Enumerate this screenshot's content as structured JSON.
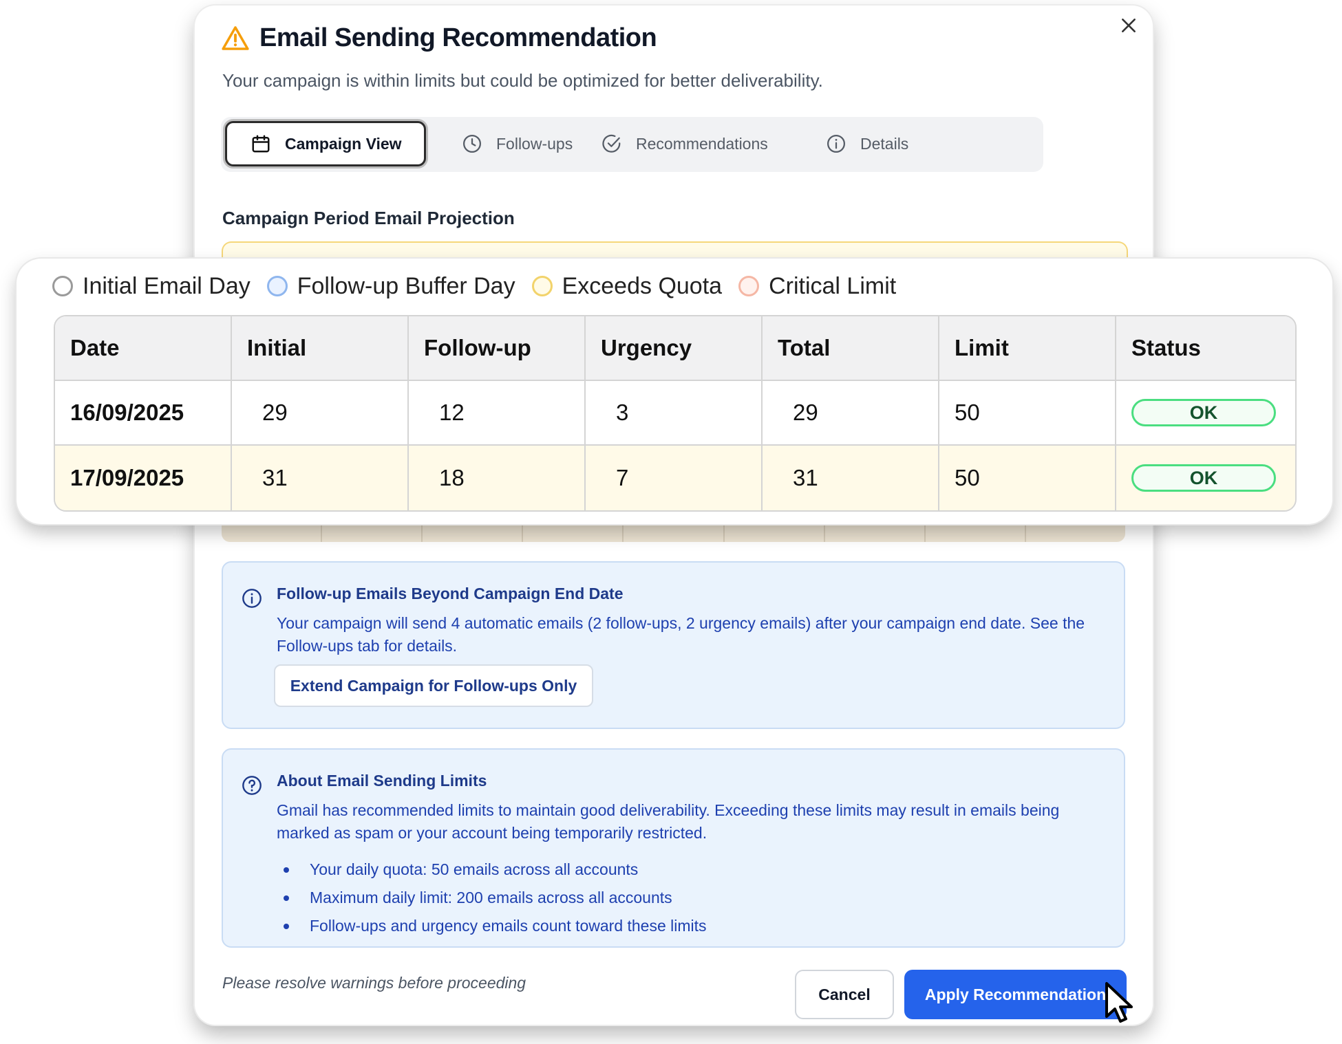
{
  "dialog": {
    "title": "Email Sending Recommendation",
    "subtitle": "Your campaign is within limits but could be optimized for better deliverability."
  },
  "tabs": [
    {
      "label": "Campaign View",
      "icon": "calendar-icon",
      "active": true
    },
    {
      "label": "Follow-ups",
      "icon": "clock-icon",
      "active": false
    },
    {
      "label": "Recommendations",
      "icon": "check-circle-icon",
      "active": false
    },
    {
      "label": "Details",
      "icon": "info-icon",
      "active": false
    }
  ],
  "section_title": "Campaign Period Email Projection",
  "legend": [
    {
      "label": "Initial Email Day",
      "color": "#ffffff"
    },
    {
      "label": "Follow-up Buffer Day",
      "color": "#eaf2ff"
    },
    {
      "label": "Exceeds Quota",
      "color": "#fffbe8"
    },
    {
      "label": "Critical Limit",
      "color": "#fff2ee"
    }
  ],
  "table": {
    "headers": [
      "Date",
      "Initial",
      "Follow-up",
      "Urgency",
      "Total",
      "Limit",
      "Status"
    ],
    "rows": [
      {
        "date": "16/09/2025",
        "initial": "29",
        "followup": "12",
        "urgency": "3",
        "total": "29",
        "limit": "50",
        "status": "OK"
      },
      {
        "date": "17/09/2025",
        "initial": "31",
        "followup": "18",
        "urgency": "7",
        "total": "31",
        "limit": "50",
        "status": "OK"
      }
    ]
  },
  "followup_notice": {
    "title": "Follow-up Emails Beyond Campaign End Date",
    "body": "Your campaign will send 4 automatic emails (2 follow-ups, 2 urgency emails) after your campaign end date. See the Follow-ups tab for details.",
    "button": "Extend Campaign for Follow-ups Only"
  },
  "limits_info": {
    "title": "About Email Sending Limits",
    "body": "Gmail has recommended limits to maintain good deliverability. Exceeding these limits may result in emails being marked as spam or your account being temporarily restricted.",
    "bullets": [
      "Your daily quota: 50 emails across all accounts",
      "Maximum daily limit: 200 emails across all accounts",
      "Follow-ups and urgency emails count toward these limits"
    ]
  },
  "footer": {
    "note": "Please resolve warnings before proceeding",
    "cancel": "Cancel",
    "apply": "Apply Recommendation"
  },
  "colors": {
    "primary": "#2563eb",
    "warning": "#f59e0b",
    "ok_border": "#4ade80",
    "info_bg": "#eaf3fd"
  }
}
